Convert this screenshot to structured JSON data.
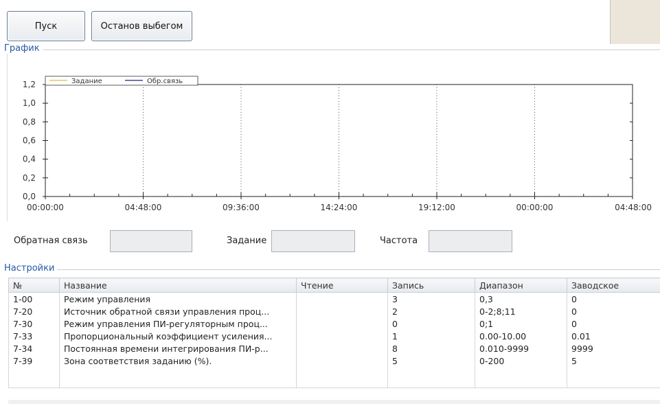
{
  "toolbar": {
    "start_label": "Пуск",
    "stop_label": "Останов выбегом"
  },
  "chart_section": {
    "title": "График"
  },
  "chart_data": {
    "type": "line",
    "title": "",
    "series": [
      {
        "name": "Задание",
        "color": "#e8b84a",
        "values": []
      },
      {
        "name": "Обр.связь",
        "color": "#1a237e",
        "values": []
      }
    ],
    "y_ticks": [
      "1,2",
      "1,0",
      "0,8",
      "0,6",
      "0,4",
      "0,2",
      "0,0"
    ],
    "ylim": [
      0,
      1.2
    ],
    "x_ticks": [
      "00:00:00",
      "04:48:00",
      "09:36:00",
      "14:24:00",
      "19:12:00",
      "00:00:00",
      "04:48:00"
    ],
    "grid": "vertical-dotted",
    "legend": "top-left"
  },
  "fields": {
    "feedback": {
      "label": "Обратная связь",
      "value": ""
    },
    "setpoint": {
      "label": "Задание",
      "value": ""
    },
    "frequency": {
      "label": "Частота",
      "value": ""
    }
  },
  "settings_section": {
    "title": "Настройки",
    "columns": [
      "№",
      "Название",
      "Чтение",
      "Запись",
      "Диапазон",
      "Заводское"
    ],
    "rows": [
      {
        "no": "1-00",
        "name": "Режим управления",
        "read": "",
        "write": "3",
        "range": "0,3",
        "factory": "0"
      },
      {
        "no": "7-20",
        "name": "Источник обратной связи управления проц...",
        "read": "",
        "write": "2",
        "range": "0-2;8;11",
        "factory": "0"
      },
      {
        "no": "7-30",
        "name": "Режим управления ПИ-регуляторным проц...",
        "read": "",
        "write": "0",
        "range": "0;1",
        "factory": "0"
      },
      {
        "no": "7-33",
        "name": "Пропорциональный коэффициент усиления...",
        "read": "",
        "write": "1",
        "range": "0.00-10.00",
        "factory": "0.01"
      },
      {
        "no": "7-34",
        "name": "Постоянная времени интегрирования ПИ-р...",
        "read": "",
        "write": "8",
        "range": "0.010-9999",
        "factory": "9999"
      },
      {
        "no": "7-39",
        "name": "Зона соответствия заданию (%).",
        "read": "",
        "write": "5",
        "range": "0-200",
        "factory": "5"
      }
    ]
  }
}
